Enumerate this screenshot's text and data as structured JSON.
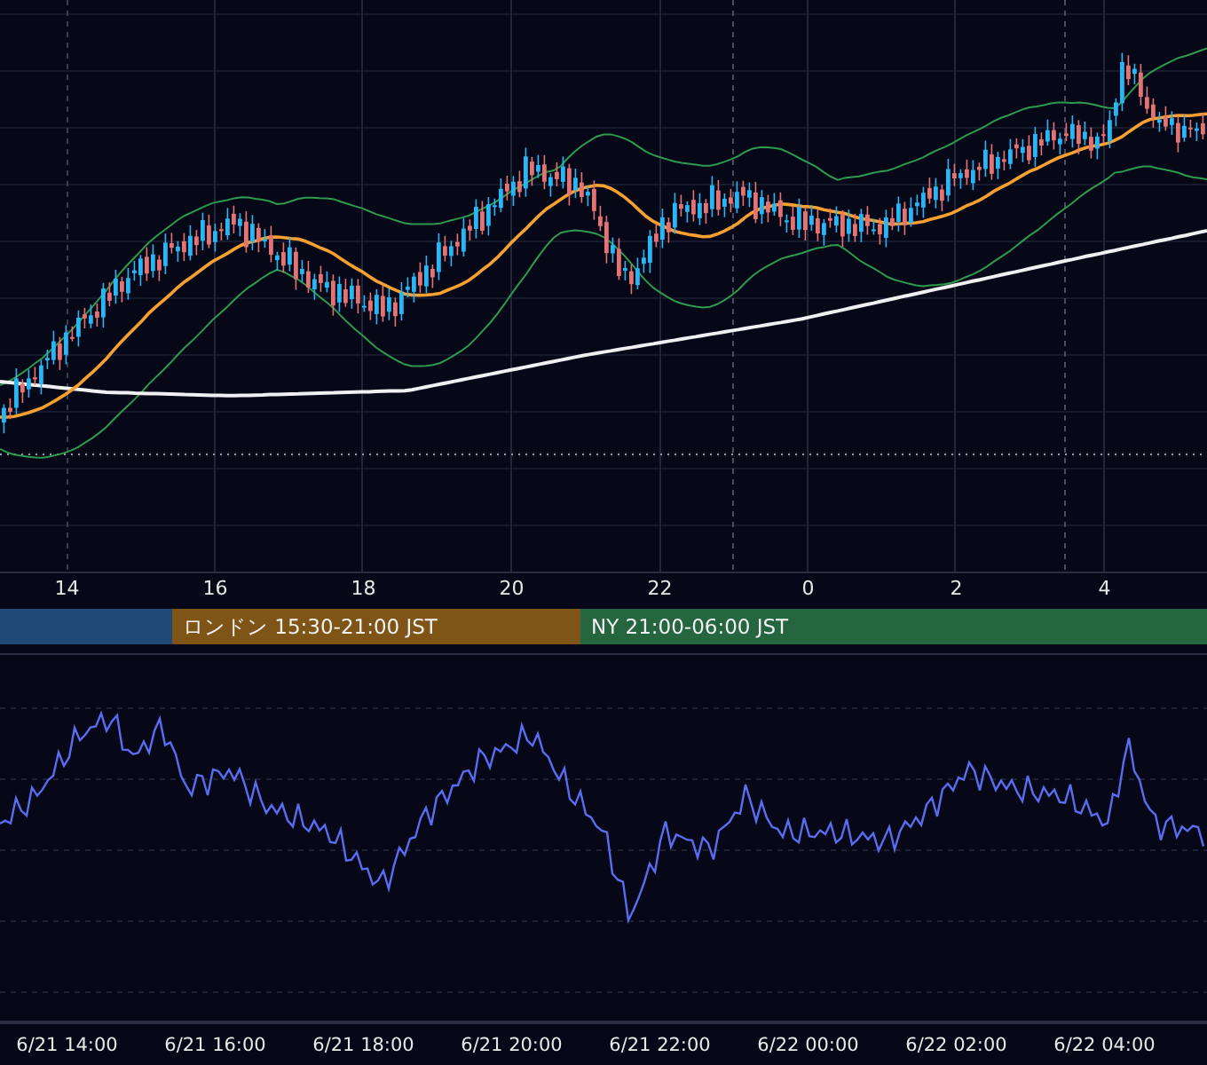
{
  "time_axis": [
    "14",
    "16",
    "18",
    "20",
    "22",
    "0",
    "2",
    "4"
  ],
  "sessions": [
    {
      "color": "#1f4a78"
    },
    {
      "label": "ロンドン 15:30-21:00 JST",
      "color": "#7e5417"
    },
    {
      "label": "NY 21:00-06:00 JST",
      "color": "#256540"
    }
  ],
  "date_axis": [
    "6/21 14:00",
    "6/21 16:00",
    "6/21 18:00",
    "6/21 20:00",
    "6/21 22:00",
    "6/22 00:00",
    "6/22 02:00",
    "6/22 04:00"
  ]
}
